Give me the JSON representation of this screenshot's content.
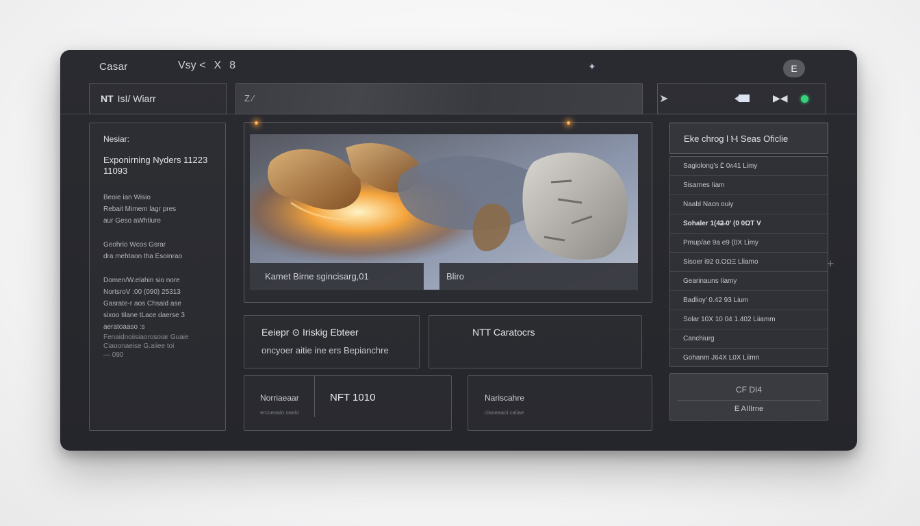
{
  "header": {
    "brand": "Casar",
    "icons": [
      "Vsy <",
      "X",
      "8"
    ],
    "sparkle": "✦",
    "avatar_label": "E"
  },
  "breadcrumb": {
    "prefix": "NT",
    "rest": "IsI/  Wiarr"
  },
  "search": {
    "text": "Z  ⁄"
  },
  "leftpanel": {
    "title": "Nesiar:",
    "heading_line1": "Exponirning Nyders 11223",
    "heading_line2": "11093",
    "block1": [
      "Beoie ian Wisio",
      "Rebait Mimem lagr pres",
      "aur Geso aWhtiure"
    ],
    "block2": [
      "Geohrio Wcos Gsrar",
      "dra mehtaon tha Esoinrao"
    ],
    "block3": [
      "Domen/W.elahin sio nore",
      "NortsroV :00 (090) 25313",
      "Gasrate-r aos Chsaid ase",
      "sixoo tilane tLace daerse 3",
      "  aeratoaaso      :s"
    ],
    "block4": [
      "Fenaidnoiisiaorosoiar Guaie",
      "Ciaoonaeise  G.aiiee toi",
      "— 090"
    ]
  },
  "hero": {
    "caption_left": "Kamet Birne sgincisarg,01",
    "caption_right": "Bliro"
  },
  "cards": {
    "card1_title": "Eeiepr ⊙  Iriskig Ebteer",
    "card1_sub": "oncyoer aitie ine ers Bepianchre",
    "card2_title": "NTT  Caratocrs",
    "card3_label": "Norriaeaar",
    "card3_sub": "ercoeaaio oaeio",
    "card3_value": "NFT 1010",
    "card4_label": "Nariscahre",
    "card4_sub": "ciaoeaaoi caiiae"
  },
  "rightpanel": {
    "header": "Eke chrog  l  Ⲙ Seas  Oficlie",
    "items": [
      {
        "label": "Sagiolong’s Ꮭ 0ᴧ41 Limy",
        "bold": false
      },
      {
        "label": "Sisarnes Iiam",
        "bold": false
      },
      {
        "label": "Naabl Nacn ouiy",
        "bold": false
      },
      {
        "label": "Sohaler 1(4̶2̶ 0′ (0 0ΩT V",
        "bold": true
      },
      {
        "label": "Pmup/ae 9a e9 (0X Limy",
        "bold": false
      },
      {
        "label": "Sisoer  i92 0.ΟΩΞ Lliamo",
        "bold": false
      },
      {
        "label": "Gearinauns Iiamy",
        "bold": false
      },
      {
        "label": "Badlioy’ 0.42 93 Lium",
        "bold": false
      },
      {
        "label": "Solar 10X 10 04 1.402 Liiamm",
        "bold": false
      },
      {
        "label": "Canchiurg",
        "bold": false
      },
      {
        "label": "Gohanm J64X  L0X Liimn",
        "bold": false
      }
    ],
    "button1": "CF DI4",
    "button2": "E  AIIIrne"
  },
  "colors": {
    "app_bg": "#2a2b30",
    "status_dot": "#34d27a"
  }
}
